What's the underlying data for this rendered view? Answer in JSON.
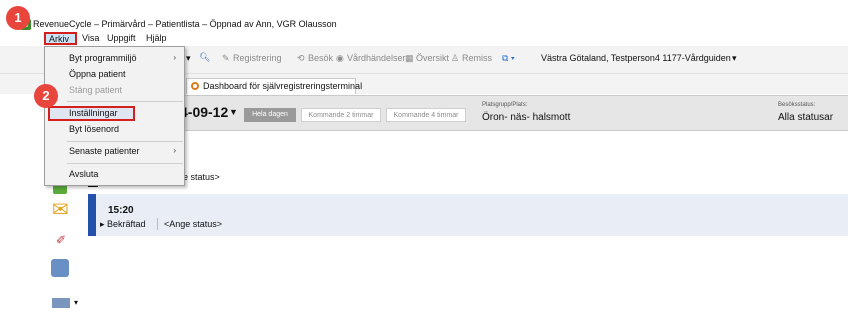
{
  "window": {
    "title": "RevenueCycle – Primärvård – Patientlista – Öppnad av Ann, VGR Olausson"
  },
  "menubar": {
    "items": [
      "Arkiv",
      "Visa",
      "Uppgift",
      "Hjälp"
    ]
  },
  "toolbar": {
    "registrering": "Registrering",
    "besok": "Besök",
    "vardhandelser": "Vårdhändelser",
    "oversikt": "Översikt",
    "remiss": "Remiss",
    "region": "Västra Götaland, Testperson4 1177-Vårdguiden"
  },
  "tabs": {
    "dashboard": "Dashboard för självregistreringsterminal"
  },
  "filter": {
    "date": "4-09-12",
    "pills": [
      "Hela dagen",
      "Kommande 2 timmar",
      "Kommande 4 timmar"
    ],
    "plats_label": "Platsgrupp/Plats:",
    "plats_value": "Öron- näs- halsmott",
    "besok_label": "Besöksstatus:",
    "besok_value": "Alla statusar"
  },
  "rows": [
    {
      "status_text": "nge status>"
    },
    {
      "time": "15:20",
      "status": "Bekräftad",
      "ange": "<Ange status>"
    }
  ],
  "dropdown": {
    "items": [
      {
        "label": "Byt programmiljö",
        "submenu": true,
        "enabled": true
      },
      {
        "label": "Öppna patient",
        "submenu": false,
        "enabled": true
      },
      {
        "label": "Stäng patient",
        "submenu": false,
        "enabled": false
      },
      {
        "label": "Inställningar",
        "submenu": false,
        "enabled": true
      },
      {
        "label": "Byt lösenord",
        "submenu": false,
        "enabled": true
      },
      {
        "label": "Senaste patienter",
        "submenu": true,
        "enabled": true
      },
      {
        "label": "Avsluta",
        "submenu": false,
        "enabled": true
      }
    ]
  },
  "badges": {
    "one": "1",
    "two": "2"
  },
  "colors": {
    "highlight": "#d41f1f",
    "accent": "#2350a8",
    "badge": "#e8453c"
  }
}
